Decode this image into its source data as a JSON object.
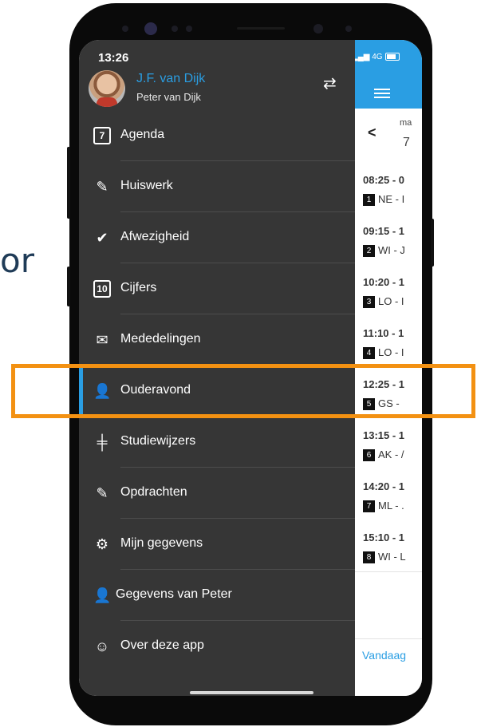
{
  "background_text": "or",
  "status": {
    "time": "13:26",
    "network": "4G"
  },
  "profile": {
    "name": "J.F. van Dijk",
    "sub": "Peter van Dijk"
  },
  "menu": [
    {
      "label": "Agenda",
      "icon": "calendar-icon",
      "glyph": "7"
    },
    {
      "label": "Huiswerk",
      "icon": "edit-icon",
      "glyph": "✎"
    },
    {
      "label": "Afwezigheid",
      "icon": "check-circle-icon",
      "glyph": "✔"
    },
    {
      "label": "Cijfers",
      "icon": "grade-icon",
      "glyph": "10"
    },
    {
      "label": "Mededelingen",
      "icon": "envelope-icon",
      "glyph": "✉"
    },
    {
      "label": "Ouderavond",
      "icon": "parent-meeting-icon",
      "glyph": "👤"
    },
    {
      "label": "Studiewijzers",
      "icon": "signpost-icon",
      "glyph": "╪"
    },
    {
      "label": "Opdrachten",
      "icon": "edit-icon",
      "glyph": "✎"
    },
    {
      "label": "Mijn gegevens",
      "icon": "gear-icon",
      "glyph": "⚙"
    },
    {
      "label": "Gegevens van Peter",
      "icon": "user-icon",
      "glyph": "👤"
    },
    {
      "label": "Over deze app",
      "icon": "info-circle-icon",
      "glyph": "☺"
    }
  ],
  "day": {
    "name": "ma",
    "number": "7"
  },
  "lessons": [
    {
      "time": "08:25 - 0",
      "num": "1",
      "subject": "NE - I"
    },
    {
      "time": "09:15 - 1",
      "num": "2",
      "subject": "WI - J"
    },
    {
      "time": "10:20 - 1",
      "num": "3",
      "subject": "LO - I"
    },
    {
      "time": "11:10 - 1",
      "num": "4",
      "subject": "LO - I"
    },
    {
      "time": "12:25 - 1",
      "num": "5",
      "subject": "GS -"
    },
    {
      "time": "13:15 - 1",
      "num": "6",
      "subject": "AK - /"
    },
    {
      "time": "14:20 - 1",
      "num": "7",
      "subject": "ML - ."
    },
    {
      "time": "15:10 - 1",
      "num": "8",
      "subject": "WI - L"
    }
  ],
  "footer": {
    "today": "Vandaag"
  },
  "colors": {
    "accent": "#2a9ee3",
    "drawer": "#363636",
    "highlight": "#f39112"
  }
}
